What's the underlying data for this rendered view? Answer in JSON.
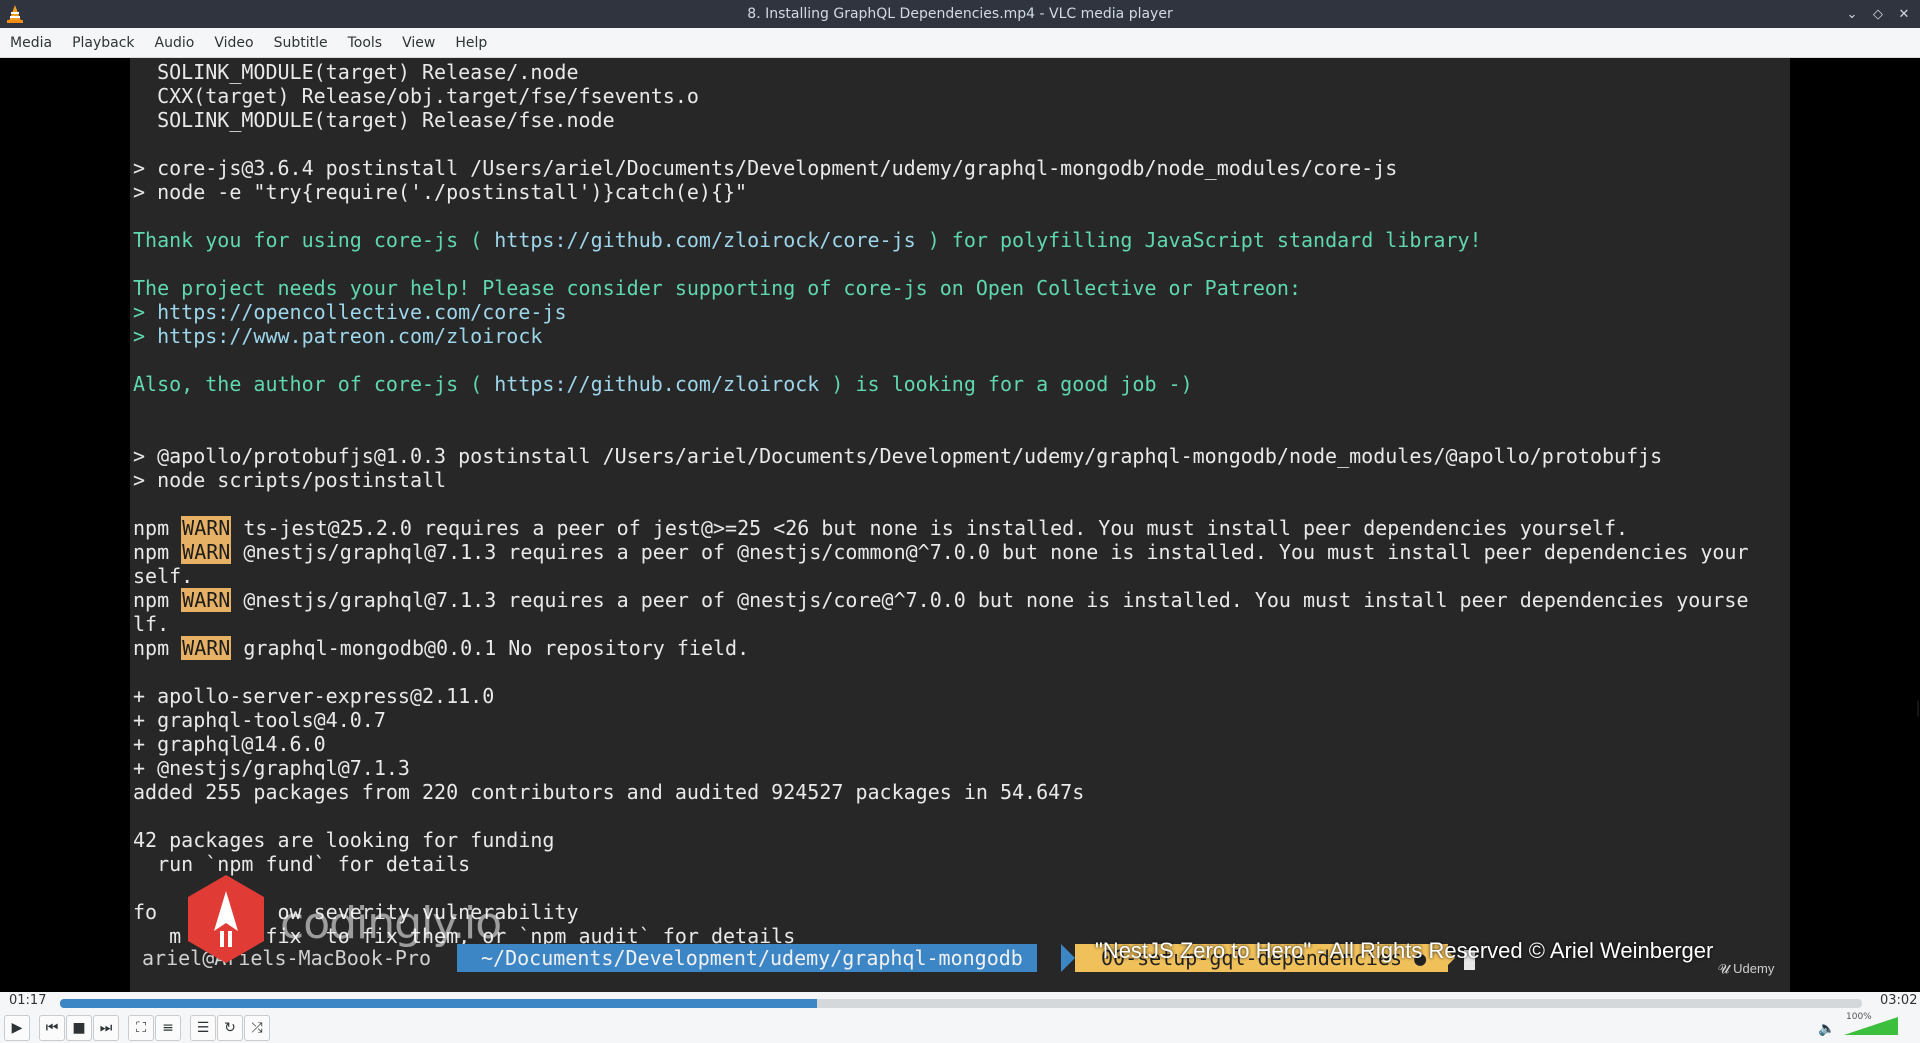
{
  "window": {
    "title": "8. Installing GraphQL Dependencies.mp4 - VLC media player"
  },
  "menu": [
    "Media",
    "Playback",
    "Audio",
    "Video",
    "Subtitle",
    "Tools",
    "View",
    "Help"
  ],
  "terminal": {
    "lines": [
      {
        "t": "  SOLINK_MODULE(target) Release/.node"
      },
      {
        "t": "  CXX(target) Release/obj.target/fse/fsevents.o"
      },
      {
        "t": "  SOLINK_MODULE(target) Release/fse.node"
      },
      {
        "t": ""
      },
      {
        "t": "> core-js@3.6.4 postinstall /Users/ariel/Documents/Development/udemy/graphql-mongodb/node_modules/core-js"
      },
      {
        "t": "> node -e \"try{require('./postinstall')}catch(e){}\""
      },
      {
        "t": ""
      },
      {
        "parts": [
          {
            "t": "Thank you for using core-js ( ",
            "c": "green"
          },
          {
            "t": "https://github.com/zloirock/core-js",
            "c": "blue"
          },
          {
            "t": " ) for polyfilling JavaScript standard library!",
            "c": "green"
          }
        ]
      },
      {
        "t": ""
      },
      {
        "parts": [
          {
            "t": "The project needs your help! Please consider supporting of core-js on Open Collective or Patreon:",
            "c": "green"
          }
        ]
      },
      {
        "parts": [
          {
            "t": "> ",
            "c": "green"
          },
          {
            "t": "https://opencollective.com/core-js",
            "c": "blue"
          }
        ]
      },
      {
        "parts": [
          {
            "t": "> ",
            "c": "green"
          },
          {
            "t": "https://www.patreon.com/zloirock",
            "c": "blue"
          }
        ]
      },
      {
        "t": ""
      },
      {
        "parts": [
          {
            "t": "Also, the author of core-js ( ",
            "c": "green"
          },
          {
            "t": "https://github.com/zloirock",
            "c": "blue"
          },
          {
            "t": " ) is looking for a good job -)",
            "c": "green"
          }
        ]
      },
      {
        "t": ""
      },
      {
        "t": ""
      },
      {
        "t": "> @apollo/protobufjs@1.0.3 postinstall /Users/ariel/Documents/Development/udemy/graphql-mongodb/node_modules/@apollo/protobufjs"
      },
      {
        "t": "> node scripts/postinstall"
      },
      {
        "t": ""
      },
      {
        "parts": [
          {
            "t": "npm "
          },
          {
            "t": "WARN",
            "c": "warn"
          },
          {
            "t": " ts-jest@25.2.0 requires a peer of jest@>=25 <26 but none is installed. You must install peer dependencies yourself."
          }
        ]
      },
      {
        "parts": [
          {
            "t": "npm "
          },
          {
            "t": "WARN",
            "c": "warn"
          },
          {
            "t": " @nestjs/graphql@7.1.3 requires a peer of @nestjs/common@^7.0.0 but none is installed. You must install peer dependencies your"
          }
        ]
      },
      {
        "t": "self."
      },
      {
        "parts": [
          {
            "t": "npm "
          },
          {
            "t": "WARN",
            "c": "warn"
          },
          {
            "t": " @nestjs/graphql@7.1.3 requires a peer of @nestjs/core@^7.0.0 but none is installed. You must install peer dependencies yourse"
          }
        ]
      },
      {
        "t": "lf."
      },
      {
        "parts": [
          {
            "t": "npm "
          },
          {
            "t": "WARN",
            "c": "warn"
          },
          {
            "t": " graphql-mongodb@0.0.1 No repository field."
          }
        ]
      },
      {
        "t": ""
      },
      {
        "t": "+ apollo-server-express@2.11.0"
      },
      {
        "t": "+ graphql-tools@4.0.7"
      },
      {
        "t": "+ graphql@14.6.0"
      },
      {
        "t": "+ @nestjs/graphql@7.1.3"
      },
      {
        "t": "added 255 packages from 220 contributors and audited 924527 packages in 54.647s"
      },
      {
        "t": ""
      },
      {
        "t": "42 packages are looking for funding"
      },
      {
        "t": "  run `npm fund` for details"
      },
      {
        "t": ""
      },
      {
        "t": "fo          ow severity vulnerability"
      },
      {
        "t": "   m audit fix  to fix them, or `npm audit` for details"
      }
    ],
    "prompt": {
      "user": "ariel@Ariels-MacBook-Pro",
      "path": "~/Documents/Development/udemy/graphql-mongodb",
      "branch": "00-setup-gql-dependencies ●"
    }
  },
  "overlay": {
    "watermark": "codingly.io",
    "copyright": "\"NestJS Zero to Hero\" - All Rights Reserved © Ariel Weinberger",
    "udemy": "Udemy"
  },
  "player": {
    "elapsed": "01:17",
    "total": "03:02",
    "progress": 0.42,
    "volume_label": "100%",
    "volume": 1.0
  }
}
